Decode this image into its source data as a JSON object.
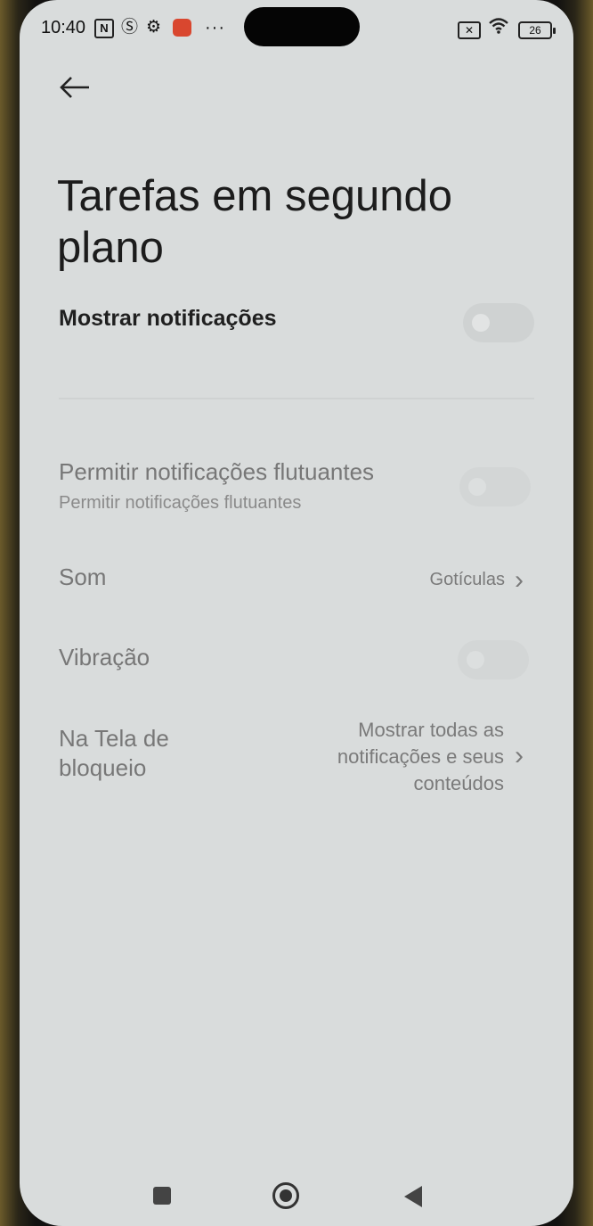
{
  "status_bar": {
    "time": "10:40",
    "nfc_icon_text": "N",
    "more_indicator": "···",
    "battery_level": "26"
  },
  "header": {
    "title": "Tarefas em segundo plano"
  },
  "settings": {
    "show_notifications": {
      "label": "Mostrar notificações",
      "enabled": false
    },
    "floating": {
      "label": "Permitir notificações flutuantes",
      "sublabel": "Permitir notificações flutuantes",
      "enabled": false
    },
    "sound": {
      "label": "Som",
      "value": "Gotículas"
    },
    "vibration": {
      "label": "Vibração",
      "enabled": false
    },
    "lock_screen": {
      "label": "Na Tela de bloqueio",
      "value": "Mostrar todas as notificações e seus conteúdos"
    }
  },
  "colors": {
    "screen_bg": "#d9dcdc",
    "text_primary": "#2a2a2a",
    "text_secondary": "#7a7a7a",
    "app_icon_red": "#d9472f"
  }
}
